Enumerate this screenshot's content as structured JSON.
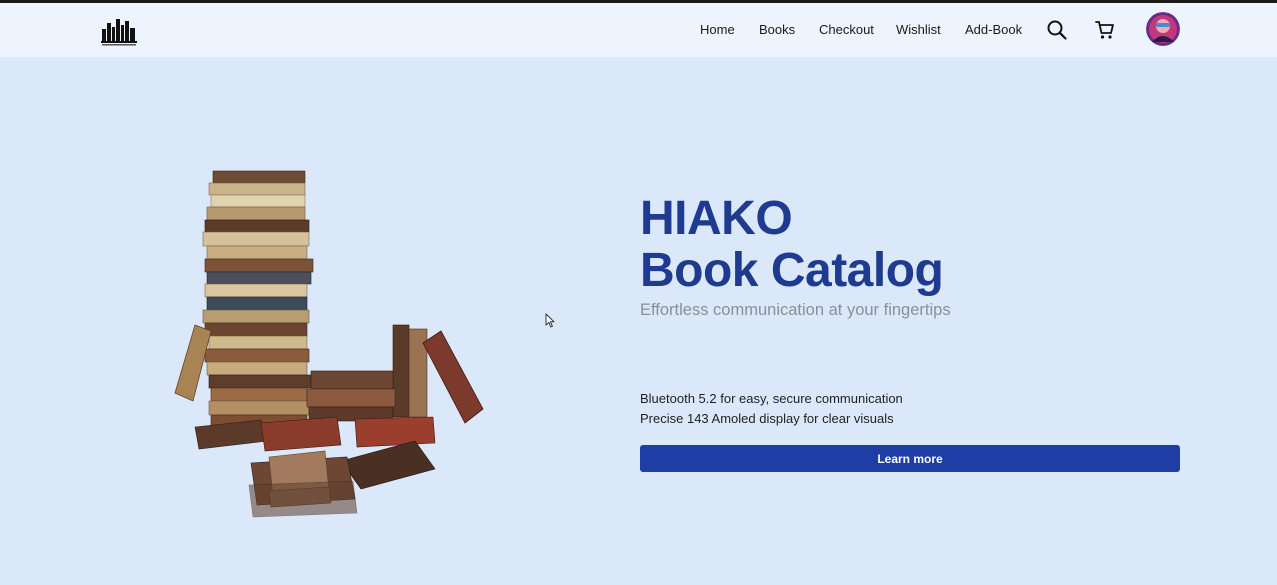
{
  "header": {
    "logo_icon": "bookshop-logo-icon",
    "nav": [
      {
        "label": "Home"
      },
      {
        "label": "Books"
      },
      {
        "label": "Checkout"
      },
      {
        "label": "Wishlist"
      },
      {
        "label": "Add-Book"
      }
    ],
    "search_icon": "search-icon",
    "cart_icon": "cart-icon",
    "avatar_icon": "user-avatar"
  },
  "hero": {
    "title_line1": "HIAKO",
    "title_line2": "Book Catalog",
    "subtitle": "Effortless communication at your fingertips",
    "features": [
      "Bluetooth 5.2 for easy, secure communication",
      "Precise 143 Amoled display for clear visuals"
    ],
    "cta_label": "Learn more",
    "image": "stacked-books-illustration"
  },
  "colors": {
    "page_bg": "#dbe8fa",
    "navbar_bg": "#eef4fd",
    "title": "#1f3b8f",
    "subtitle": "#8c8f96",
    "button": "#1f3ea5"
  }
}
